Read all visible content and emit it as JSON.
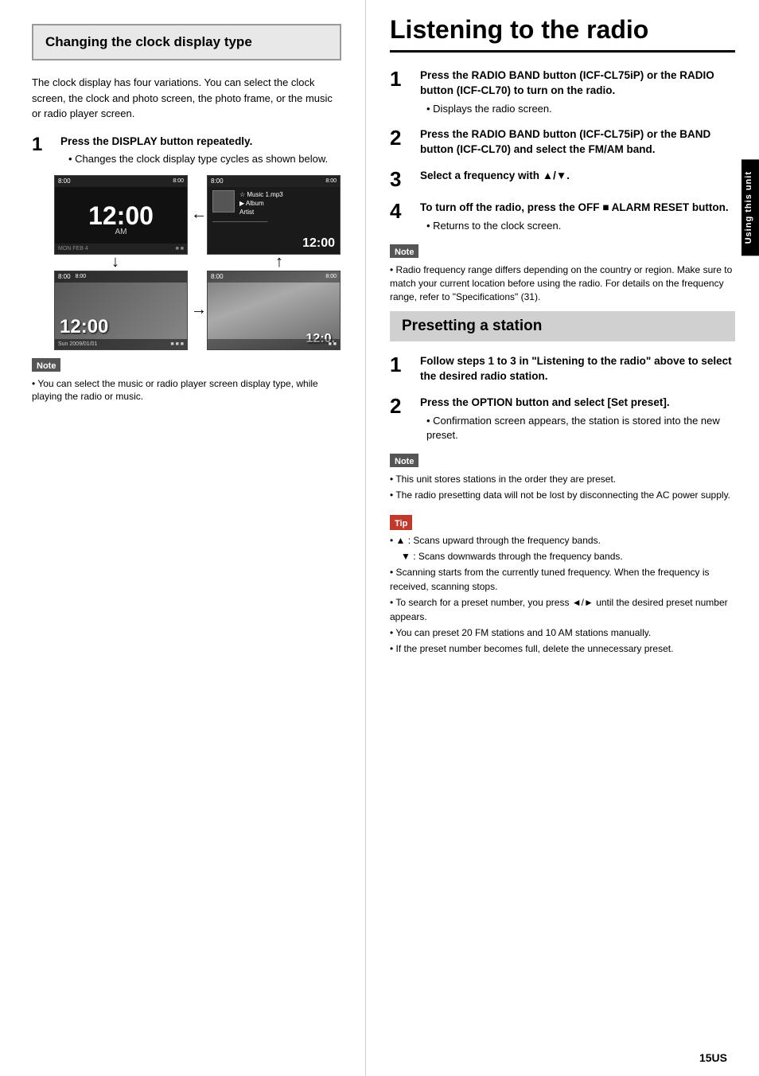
{
  "left": {
    "section_title": "Changing the clock display type",
    "body_text": "The clock display has four variations. You can select the clock screen, the clock and photo screen, the photo frame, or the music or radio player screen.",
    "step1_title": "Press the DISPLAY button repeatedly.",
    "step1_bullet": "Changes the clock display type cycles as shown below.",
    "note_label": "Note",
    "note_text": "You can select the music or radio player screen display type, while playing the radio or music.",
    "clock_times": [
      "12:00",
      "12:00",
      "12:00"
    ],
    "clock_am": "AM"
  },
  "right": {
    "main_title": "Listening to the radio",
    "steps": [
      {
        "num": "1",
        "title": "Press the RADIO BAND button (ICF-CL75iP) or the RADIO button (ICF-CL70) to turn on the radio.",
        "bullet": "Displays the radio screen."
      },
      {
        "num": "2",
        "title": "Press the RADIO BAND button (ICF-CL75iP) or the BAND button (ICF-CL70) and select the FM/AM band."
      },
      {
        "num": "3",
        "title": "Select a frequency with ▲/▼."
      },
      {
        "num": "4",
        "title": "To turn off the radio, press the OFF ■ ALARM RESET button.",
        "bullet": "Returns to the clock screen."
      }
    ],
    "note_label": "Note",
    "note_text": "Radio frequency range differs depending on the country or region. Make sure to match your current location before using the radio. For details on the frequency range, refer to \"Specifications\" (31).",
    "preset_title": "Presetting a station",
    "preset_steps": [
      {
        "num": "1",
        "title": "Follow steps 1 to 3 in \"Listening to the radio\" above to select the desired radio station."
      },
      {
        "num": "2",
        "title": "Press the OPTION button and select [Set preset].",
        "bullet": "Confirmation screen appears, the station is stored into the new preset."
      }
    ],
    "preset_note_label": "Note",
    "preset_note_lines": [
      "This unit stores stations in the order they are preset.",
      "The radio presetting data will not be lost by disconnecting the AC power supply."
    ],
    "tip_label": "Tip",
    "tip_lines": [
      "▲ : Scans upward through the frequency bands.",
      "▼ : Scans downwards through the frequency bands.",
      "Scanning starts from the currently tuned frequency. When the frequency is received, scanning stops.",
      "To search for a preset number, you press ◄/► until the desired preset number appears.",
      "You can preset 20 FM stations and 10 AM stations manually.",
      "If the preset number becomes full, delete the unnecessary preset."
    ]
  },
  "sidebar": {
    "label": "Using this unit"
  },
  "page_number": "15US"
}
